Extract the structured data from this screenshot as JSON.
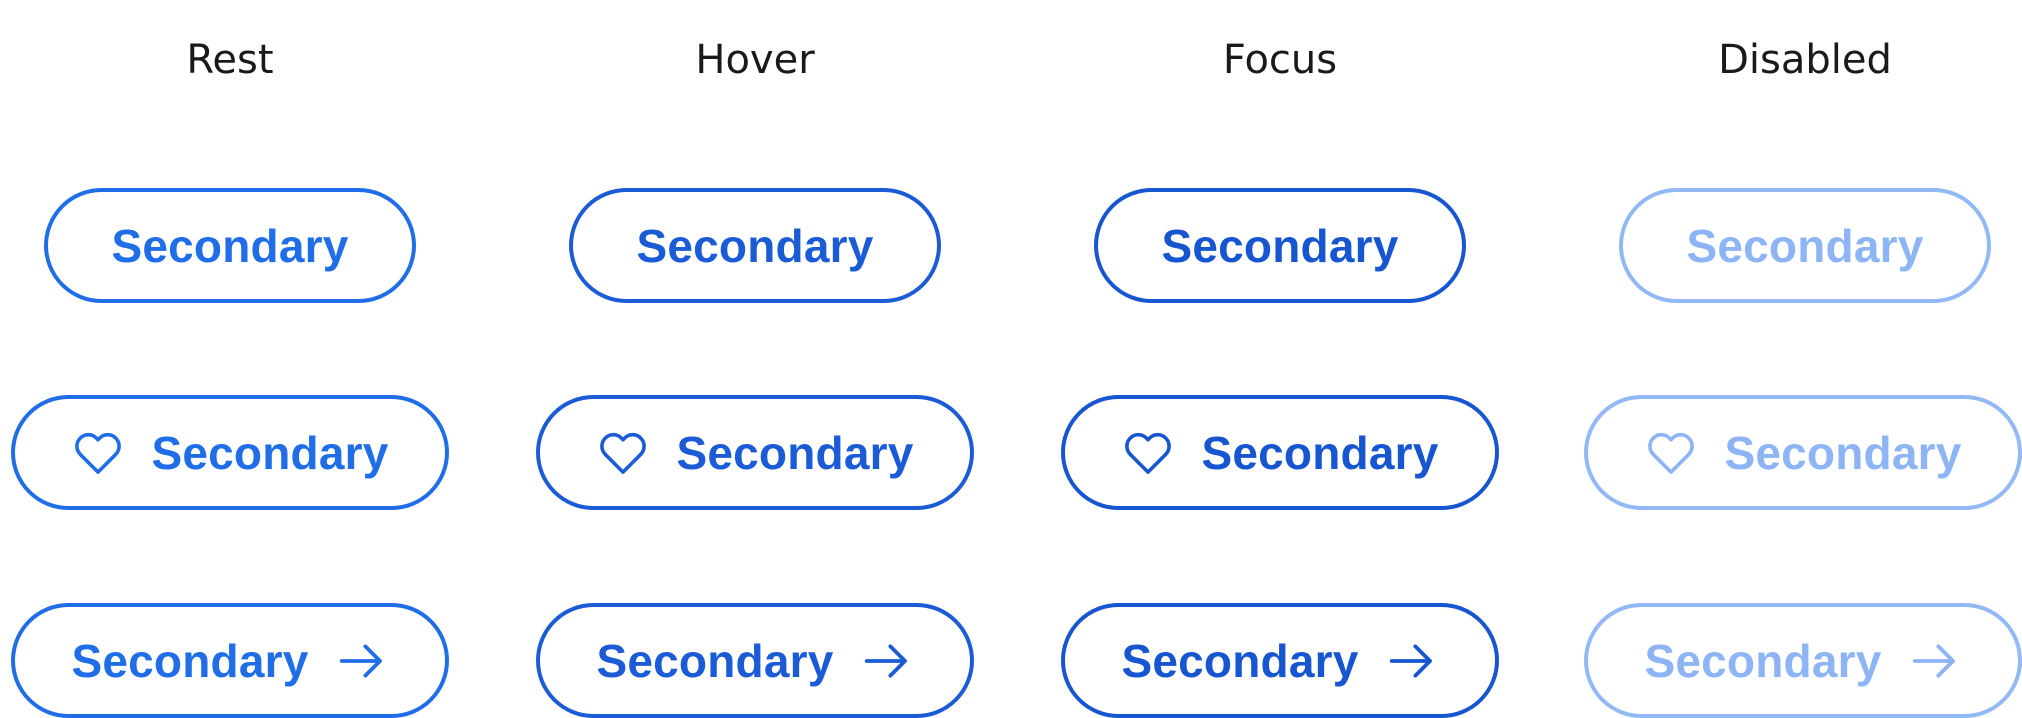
{
  "columns": [
    {
      "key": "rest",
      "title": "Rest"
    },
    {
      "key": "hover",
      "title": "Hover"
    },
    {
      "key": "focus",
      "title": "Focus"
    },
    {
      "key": "disabled",
      "title": "Disabled"
    }
  ],
  "button": {
    "label": "Secondary",
    "leading_icon": "heart-icon",
    "trailing_icon": "arrow-right-icon"
  },
  "colors": {
    "rest": "#1f6ee8",
    "hover": "#1b5cd6",
    "focus": "#1656d0",
    "disabled": "#93b9f5",
    "header_text": "#1a1a1a",
    "background": "#ffffff"
  }
}
